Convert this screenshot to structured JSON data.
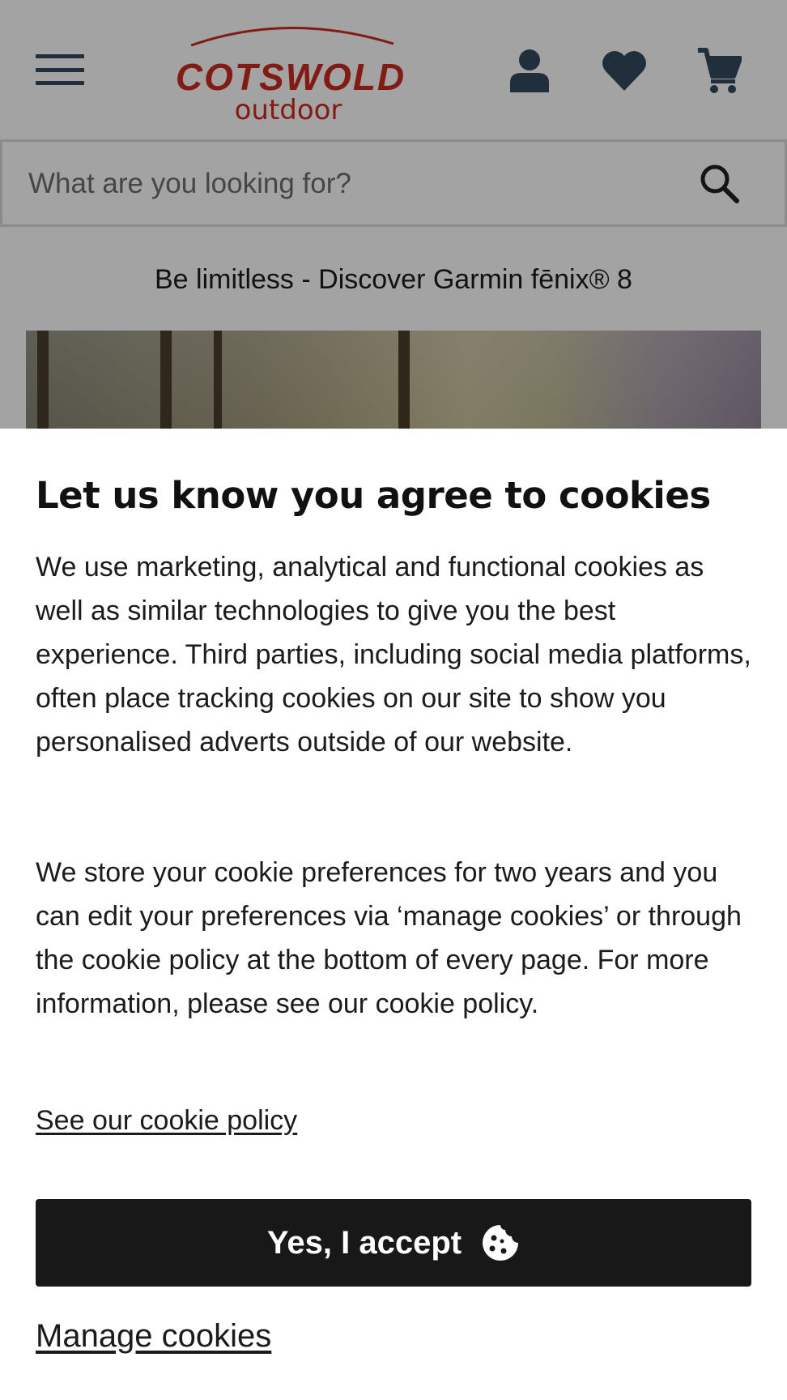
{
  "header": {
    "menu_icon": "hamburger-menu-icon",
    "logo": {
      "line1": "COTSWOLD",
      "line2": "outdoor",
      "color": "#cc2b1f"
    },
    "icons": [
      "account-icon",
      "wishlist-heart-icon",
      "cart-icon"
    ],
    "icon_color": "#34495e"
  },
  "search": {
    "placeholder": "What are you looking for?",
    "icon": "search-icon"
  },
  "promo": {
    "text": "Be limitless - Discover Garmin fēnix® 8"
  },
  "cookie_banner": {
    "title": "Let us know you agree to cookies",
    "paragraph1": "We use marketing, analytical and functional cookies as well as similar technologies to give you the best experience. Third parties, including social media platforms, often place tracking cookies on our site to show you personalised adverts outside of our website.",
    "paragraph2": "We store your cookie preferences for two years and you can edit your preferences via ‘manage cookies’ or through the cookie policy at the bottom of every page. For more information, please see our cookie policy.",
    "policy_link": "See our cookie policy",
    "accept_button": "Yes, I accept",
    "accept_icon": "cookie-icon",
    "manage_link": "Manage cookies",
    "button_color": "#181818"
  }
}
